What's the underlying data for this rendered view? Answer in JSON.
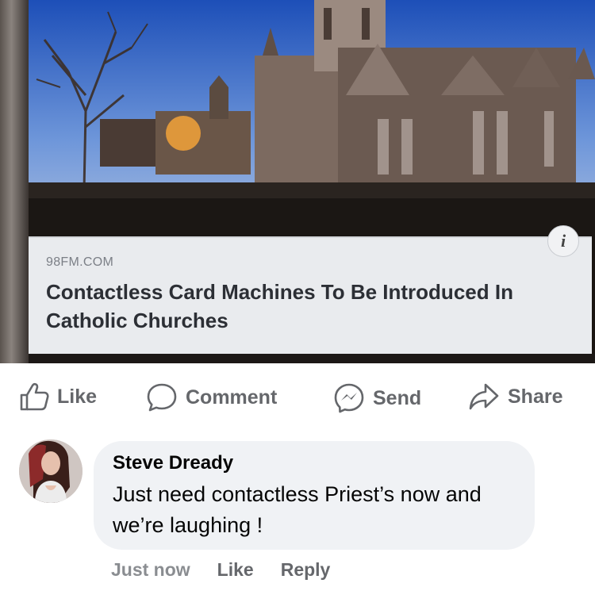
{
  "post": {
    "link_domain": "98FM.COM",
    "link_title": "Contactless Card Machines To Be Introduced In Catholic Churches",
    "info_icon_glyph": "i"
  },
  "actions": {
    "like_label": "Like",
    "comment_label": "Comment",
    "send_label": "Send",
    "share_label": "Share",
    "text_color": "#65676b"
  },
  "comment": {
    "author": "Steve Dready",
    "text": "Just need contactless Priest’s now and we’re laughing !",
    "time": "Just now",
    "like_label": "Like",
    "reply_label": "Reply",
    "bubble_color": "#f0f2f5"
  },
  "icons": {
    "like": "thumbs-up-icon",
    "comment": "speech-bubble-icon",
    "send": "messenger-icon",
    "share": "share-arrow-icon",
    "info": "info-icon"
  }
}
